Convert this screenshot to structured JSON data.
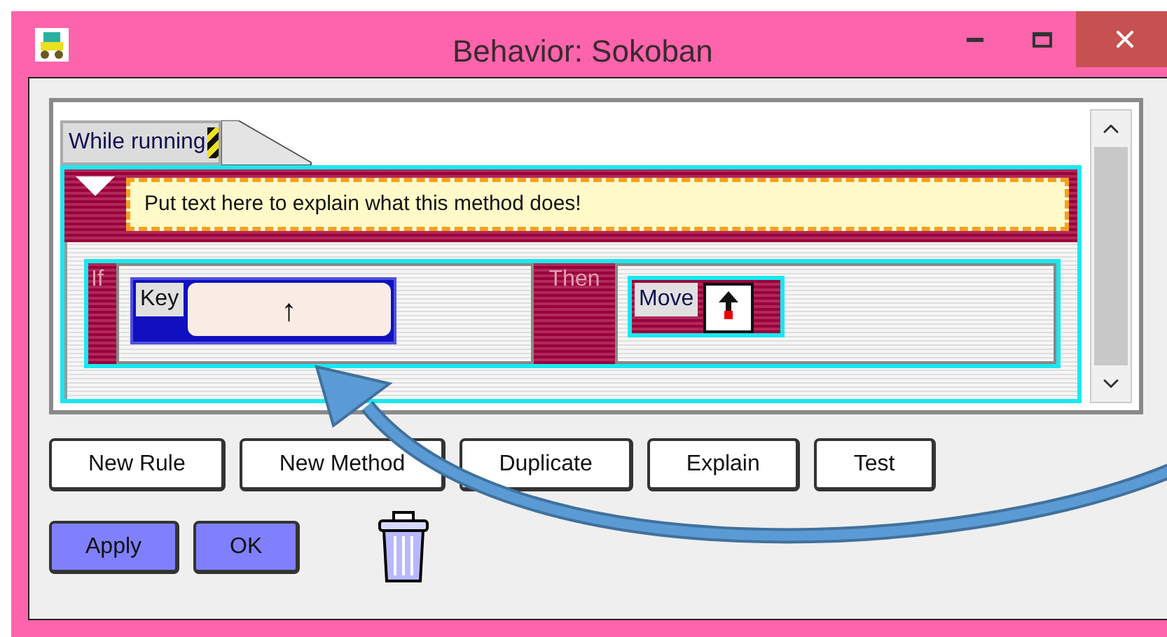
{
  "window": {
    "title": "Behavior: Sokoban"
  },
  "method": {
    "trigger": "While running",
    "expanded": true,
    "description": "Put text here to explain what this method does!",
    "rule": {
      "if_label": "If",
      "then_label": "Then",
      "condition": {
        "label": "Key",
        "key": "↑"
      },
      "action": {
        "label": "Move"
      }
    }
  },
  "buttons": [
    "New Rule",
    "New Method",
    "Duplicate",
    "Explain",
    "Test"
  ],
  "dialog_buttons": [
    "Apply",
    "OK"
  ]
}
